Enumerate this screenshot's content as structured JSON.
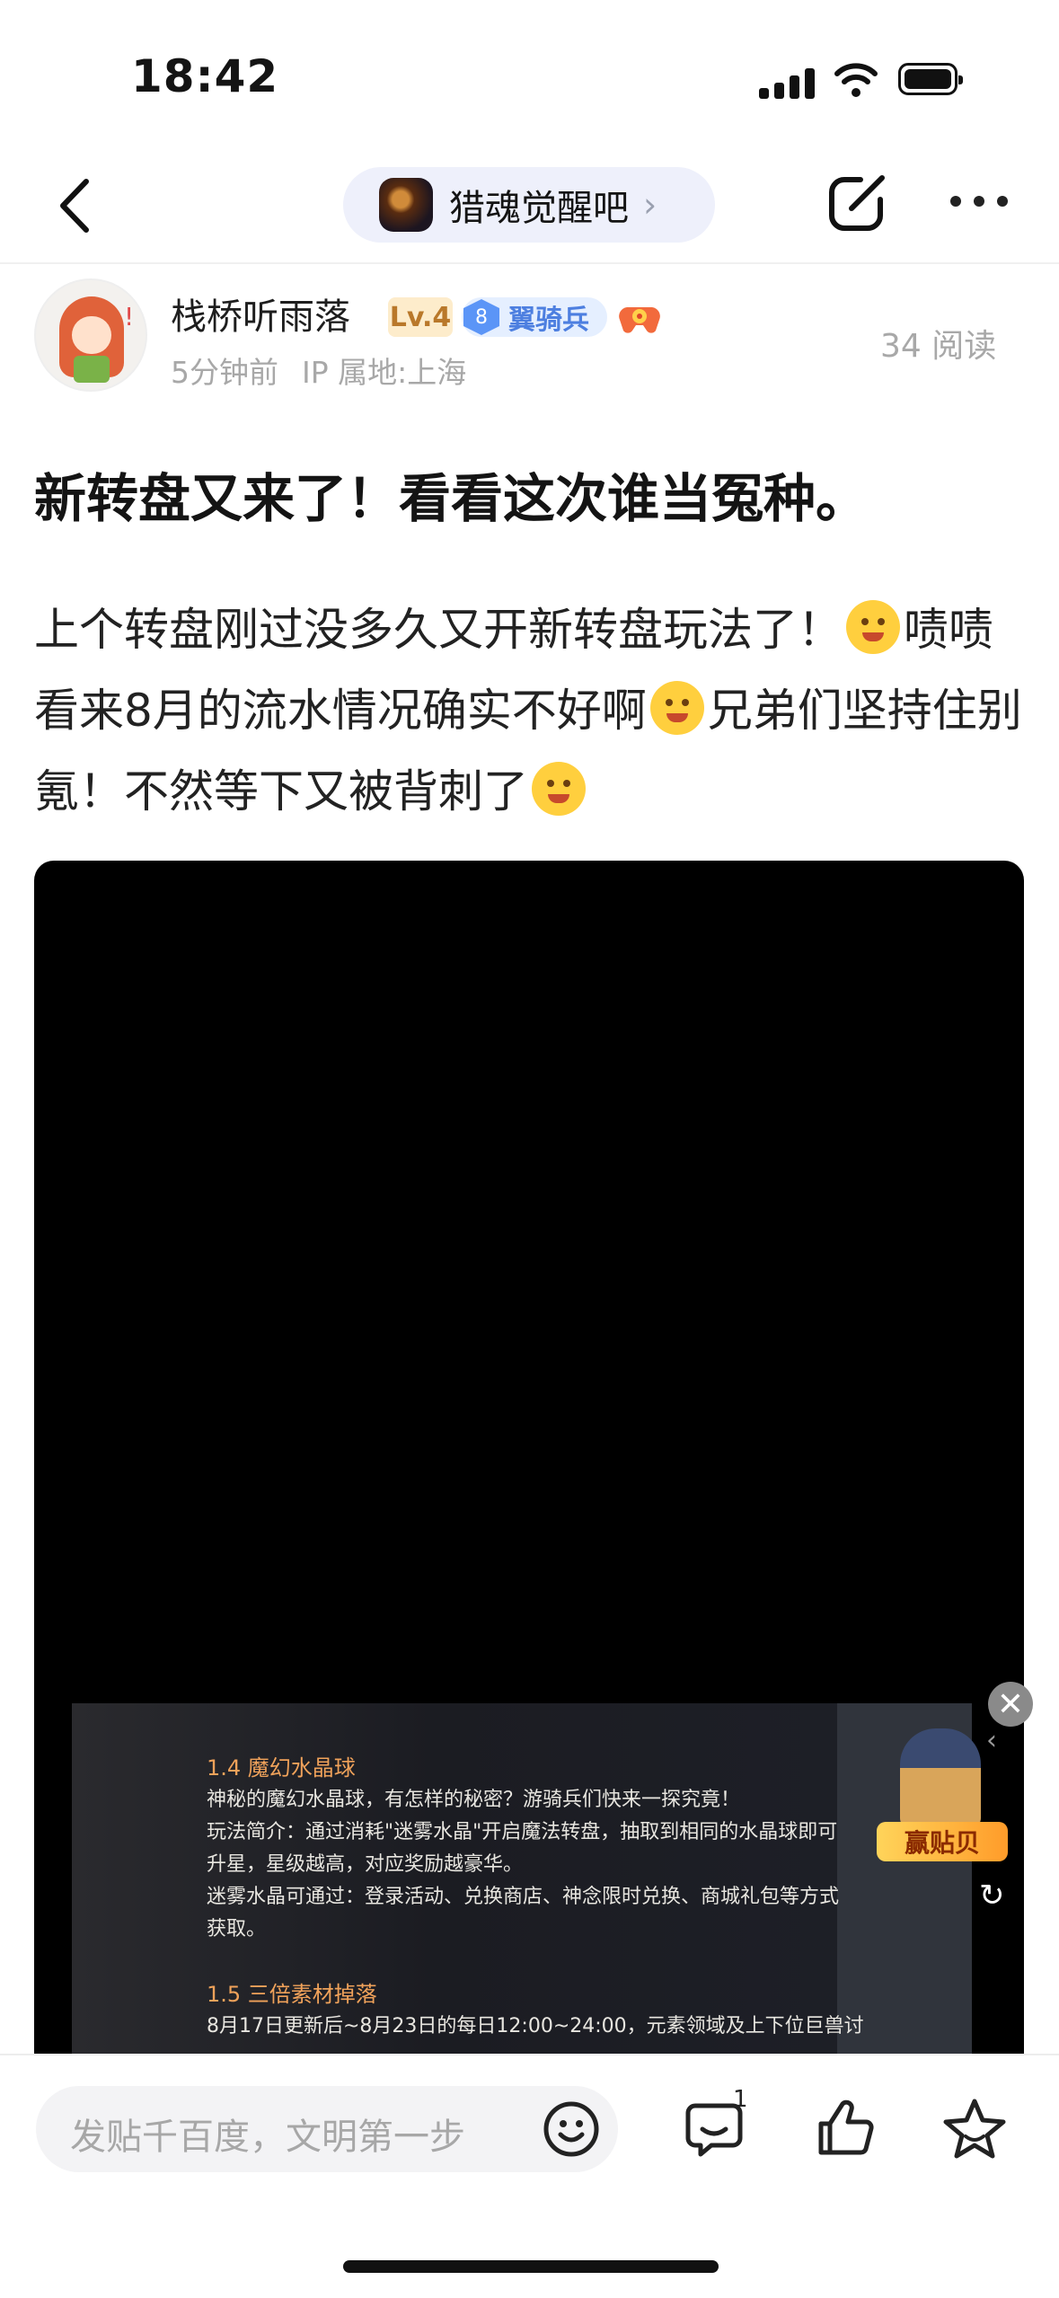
{
  "status_bar": {
    "time": "18:42"
  },
  "nav": {
    "forum_name": "猎魂觉醒吧",
    "forum_chevron": "›"
  },
  "author": {
    "username": "栈桥听雨落",
    "level": "Lv.4",
    "rank_number": "8",
    "rank_title": "翼骑兵",
    "time_ago": "5分钟前",
    "ip_location": "IP 属地:上海",
    "avatar_mark": "!",
    "read_count": "34 阅读"
  },
  "post": {
    "title": "新转盘又来了！看看这次谁当冤种。",
    "body_part1": "上个转盘刚过没多久又开新转盘玩法了！",
    "body_part2": "啧啧看来8月的流水情况确实不好啊",
    "body_part3": "兄弟们坚持住别氪！不然等下又被背刺了"
  },
  "video_pip": {
    "heading_1": "1.4 魔幻水晶球",
    "line_1": "神秘的魔幻水晶球，有怎样的秘密？游骑兵们快来一探究竟！",
    "line_2": "玩法简介：通过消耗\"迷雾水晶\"开启魔法转盘，抽取到相同的水晶球即可",
    "line_3": "升星，星级越高，对应奖励越豪华。",
    "line_4": "迷雾水晶可通过：登录活动、兑换商店、神念限时兑换、商城礼包等方式",
    "line_5": "获取。",
    "heading_2": "1.5 三倍素材掉落",
    "line_6": "8月17日更新后~8月23日的每日12:00~24:00，元素领域及上下位巨兽讨",
    "close_glyph": "✕",
    "promo_label": "赢贴贝",
    "refresh_glyph": "↻",
    "collapse_glyph": "‹"
  },
  "bottom_bar": {
    "input_placeholder": "发贴千百度，文明第一步",
    "comment_count": "1"
  }
}
